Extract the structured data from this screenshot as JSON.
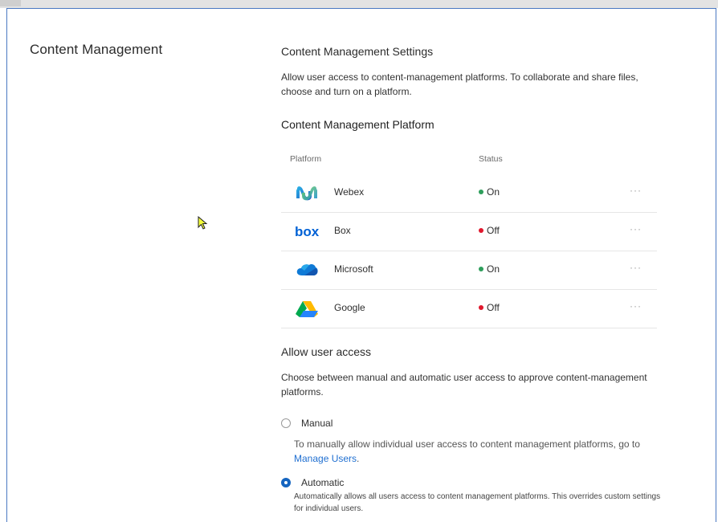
{
  "section": {
    "title": "Content Management"
  },
  "settings": {
    "heading": "Content Management Settings",
    "description": "Allow user access to content-management platforms. To collaborate and share files, choose and turn on a platform."
  },
  "platform_section": {
    "heading": "Content Management Platform",
    "columns": {
      "platform": "Platform",
      "status": "Status"
    },
    "rows": [
      {
        "name": "Webex",
        "status": "On",
        "status_color": "#2e9e5b",
        "icon": "webex-icon"
      },
      {
        "name": "Box",
        "status": "Off",
        "status_color": "#e0182d",
        "icon": "box-icon"
      },
      {
        "name": "Microsoft",
        "status": "On",
        "status_color": "#2e9e5b",
        "icon": "onedrive-icon"
      },
      {
        "name": "Google",
        "status": "Off",
        "status_color": "#e0182d",
        "icon": "google-drive-icon"
      }
    ],
    "more_label": "···"
  },
  "access": {
    "heading": "Allow user access",
    "description": "Choose between manual and automatic user access to approve content-management platforms.",
    "manual": {
      "label": "Manual",
      "help_prefix": "To manually allow individual user access to content management platforms, go to ",
      "help_link": "Manage Users",
      "help_suffix": ".",
      "selected": false
    },
    "automatic": {
      "label": "Automatic",
      "help": "Automatically allows all users access to content management platforms. This overrides custom settings for individual users.",
      "selected": true
    }
  },
  "colors": {
    "accent": "#1565c0",
    "link": "#1f6fd1",
    "frame": "#4a78c2"
  }
}
